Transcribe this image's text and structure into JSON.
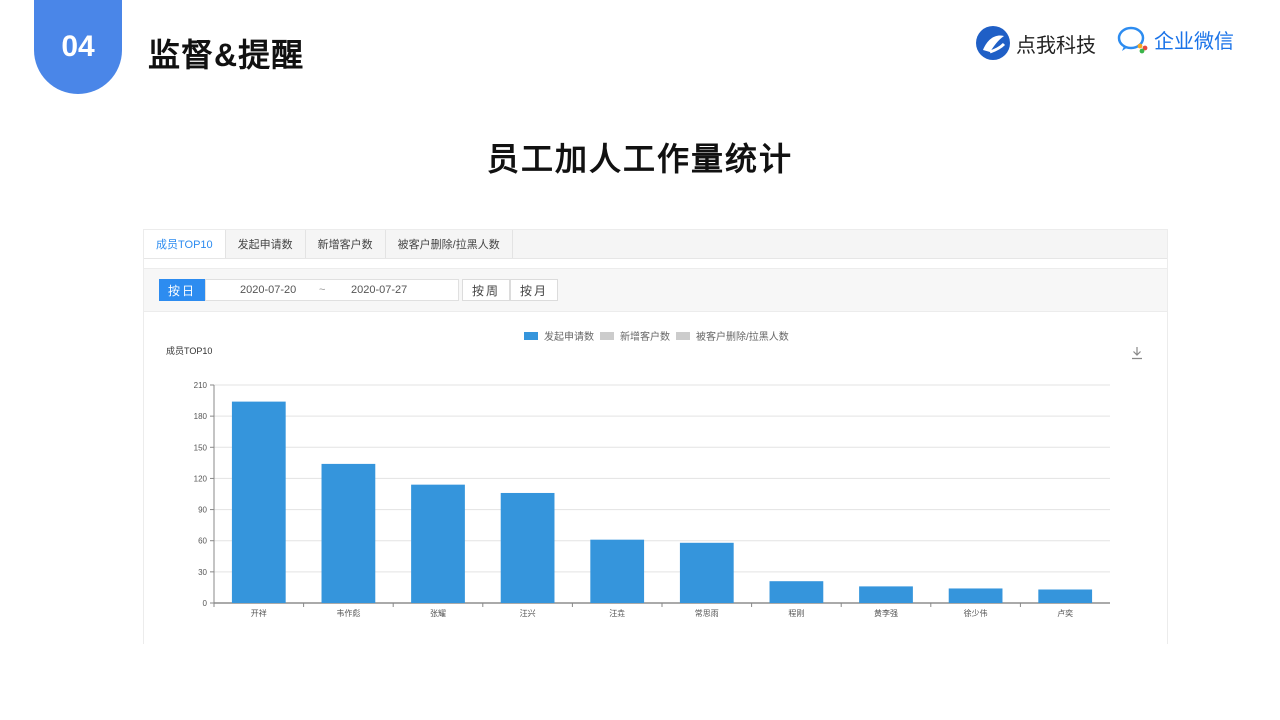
{
  "slide": {
    "number": "04",
    "title": "监督&提醒",
    "brand_dianwo": "点我科技",
    "brand_wework": "企业微信",
    "heading": "员工加人工作量统计"
  },
  "tabs": [
    "成员TOP10",
    "发起申请数",
    "新增客户数",
    "被客户删除/拉黑人数"
  ],
  "filters": {
    "by_day": "按日",
    "date_start": "2020-07-20",
    "date_sep": "~",
    "date_end": "2020-07-27",
    "by_week": "按周",
    "by_month": "按月"
  },
  "colors": {
    "bar": "#3595dc",
    "legend_inactive": "#cccccc",
    "accent": "#2d8cf0"
  },
  "icons": {
    "download": "download-icon",
    "dianwo_logo": "dianwo-logo-icon",
    "wework_logo": "wework-logo-icon"
  },
  "chart_data": {
    "type": "bar",
    "title": "成员TOP10",
    "categories": [
      "开祥",
      "韦作彪",
      "张耀",
      "汪兴",
      "汪垚",
      "常思雨",
      "程刚",
      "黄李强",
      "徐少伟",
      "卢奕"
    ],
    "series": [
      {
        "name": "发起申请数",
        "values": [
          194,
          134,
          114,
          106,
          61,
          58,
          21,
          16,
          14,
          13
        ]
      },
      {
        "name": "新增客户数",
        "values": []
      },
      {
        "name": "被客户删除/拉黑人数",
        "values": []
      }
    ],
    "yticks": [
      "0",
      "30",
      "60",
      "90",
      "120",
      "150",
      "180",
      "210"
    ],
    "ylim": [
      0,
      210
    ],
    "grid": true,
    "legend_position": "top-center"
  }
}
